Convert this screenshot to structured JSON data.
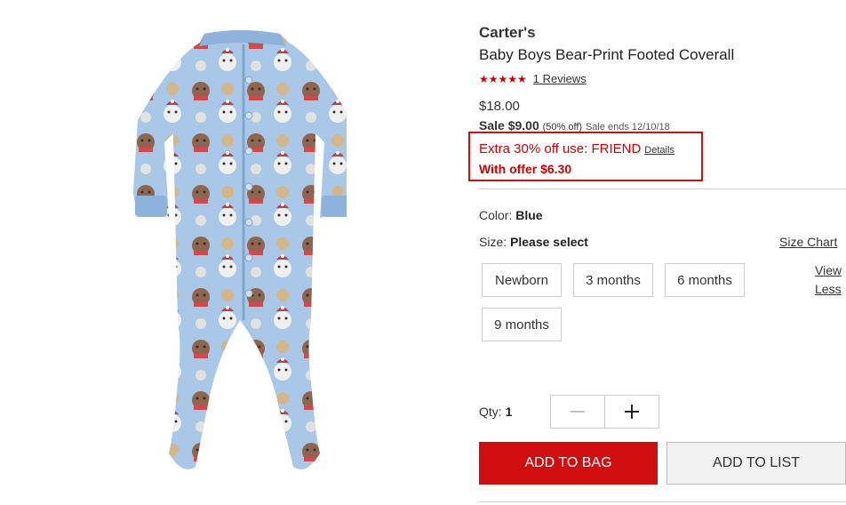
{
  "product": {
    "brand": "Carter's",
    "title": "Baby Boys Bear-Print Footed Coverall",
    "stars": "★★★★★",
    "rating_value": 5,
    "reviews_link": "1 Reviews",
    "original_price": "$18.00",
    "sale_label": "Sale $9.00",
    "sale_percent": "(50% off)",
    "sale_ends": "Sale ends 12/10/18"
  },
  "offer": {
    "text": "Extra 30% off use: FRIEND",
    "details_link": "Details",
    "with_offer": "With offer $6.30",
    "accent_color": "#c00"
  },
  "color": {
    "label": "Color:",
    "value": "Blue"
  },
  "size": {
    "label": "Size:",
    "value": "Please select",
    "chart_link": "Size Chart",
    "options": [
      "Newborn",
      "3 months",
      "6 months",
      "9 months"
    ],
    "view_less": "View Less"
  },
  "quantity": {
    "label": "Qty:",
    "value": "1",
    "minus_icon": "minus-icon",
    "plus_icon": "plus-icon"
  },
  "actions": {
    "add_to_bag": "ADD TO BAG",
    "add_to_list": "ADD TO LIST",
    "bag_color": "#d10e0e"
  },
  "image": {
    "description_icon": "product-photo"
  }
}
